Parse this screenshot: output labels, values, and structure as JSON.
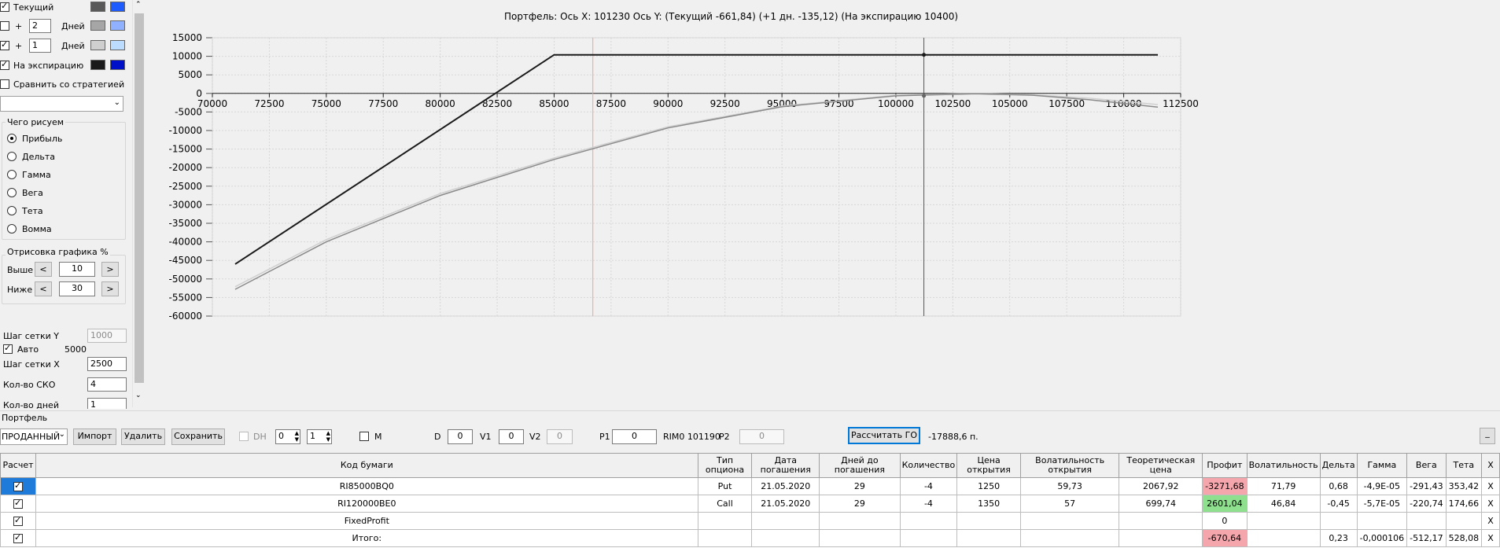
{
  "left": {
    "rows": [
      {
        "checked": true,
        "label": "Текущий",
        "swatch1": "#595959",
        "swatch2": "#1e5bff"
      },
      {
        "checked": false,
        "plus": "+",
        "value": "2",
        "unit": "Дней",
        "swatch1": "#a6a6a6",
        "swatch2": "#8fb1ff"
      },
      {
        "checked": true,
        "plus": "+",
        "value": "1",
        "unit": "Дней",
        "swatch1": "#cfcfcf",
        "swatch2": "#bcdcff"
      },
      {
        "checked": true,
        "label": "На экспирацию",
        "swatch1": "#1a1a1a",
        "swatch2": "#0010c8"
      }
    ],
    "compare_label": "Сравнить со стратегией",
    "draw_group_title": "Чего рисуем",
    "draw_options": [
      "Прибыль",
      "Дельта",
      "Гамма",
      "Вега",
      "Тета",
      "Вомма"
    ],
    "draw_selected": 0,
    "range_group_title": "Отрисовка графика %",
    "above_label": "Выше",
    "above_value": "10",
    "below_label": "Ниже",
    "below_value": "30",
    "dec": "<",
    "inc": ">",
    "grid_y_label": "Шаг сетки Y",
    "grid_y_value": "1000",
    "auto_label": "Авто",
    "auto_value": "5000",
    "grid_x_label": "Шаг сетки X",
    "grid_x_value": "2500",
    "sko_label": "Кол-во СКО",
    "sko_value": "4",
    "days_label": "Кол-во дней",
    "days_value": "1"
  },
  "chart_data": {
    "type": "line",
    "title": "Портфель: Ось X: 101230 Ось Y:  (Текущий -661,84)  (+1 дн. -135,12)  (На экспирацию 10400)",
    "x_ticks": [
      70000,
      72500,
      75000,
      77500,
      80000,
      82500,
      85000,
      87500,
      90000,
      92500,
      95000,
      97500,
      100000,
      102500,
      105000,
      107500,
      110000,
      112500
    ],
    "y_ticks": [
      15000,
      10000,
      5000,
      0,
      -5000,
      -10000,
      -15000,
      -20000,
      -25000,
      -30000,
      -35000,
      -40000,
      -45000,
      -50000,
      -55000,
      -60000
    ],
    "xlim": [
      70000,
      112500
    ],
    "ylim": [
      -60000,
      15000
    ],
    "grid": true,
    "cursor_x": 101230,
    "red_marker_x": 86700,
    "series": [
      {
        "color": "#1a1a1a",
        "x": [
          71000,
          85000,
          111500
        ],
        "y": [
          -46000,
          10400,
          10400
        ]
      },
      {
        "color": "#8a8a8a",
        "x": [
          71000,
          75000,
          80000,
          85000,
          90000,
          95000,
          100000,
          103500,
          106000,
          108500,
          111500
        ],
        "y": [
          -52800,
          -40000,
          -27500,
          -17800,
          -9300,
          -3600,
          -640,
          -100,
          -500,
          -1700,
          -3700
        ]
      },
      {
        "color": "#cfcfcf",
        "x": [
          71000,
          75000,
          80000,
          85000,
          90000,
          95000,
          100000,
          103500,
          106000,
          108500,
          111500
        ],
        "y": [
          -52100,
          -39400,
          -27000,
          -17400,
          -9000,
          -3400,
          -500,
          0,
          -350,
          -1300,
          -3000
        ]
      }
    ]
  },
  "bottom": {
    "tab": "Портфель",
    "combo_value": "ПРОДАННЫЙ",
    "import": "Импорт",
    "delete": "Удалить",
    "save": "Сохранить",
    "dh": "DH",
    "spin1": "0",
    "spin2": "1",
    "m": "M",
    "d_label": "D",
    "d_value": "0",
    "v1_label": "V1",
    "v1_value": "0",
    "v2_label": "V2",
    "v2_value": "0",
    "p1_label": "P1",
    "p1_value": "0",
    "rim": "RIM0 101190",
    "p2_label": "P2",
    "p2_value": "0",
    "calc_go": "Рассчитать ГО",
    "go_value": "-17888,6 п.",
    "min_btn": "_"
  },
  "table": {
    "headers": [
      "Расчет",
      "Код бумаги",
      "Тип опциона",
      "Дата погашения",
      "Дней до погашения",
      "Количество",
      "Цена открытия",
      "Волатильность открытия",
      "Теоретическая цена",
      "Профит",
      "Волатильность",
      "Дельта",
      "Гамма",
      "Вега",
      "Тета",
      "X"
    ],
    "rows": [
      [
        "",
        "RI85000BQ0",
        "Put",
        "21.05.2020",
        "29",
        "-4",
        "1250",
        "59,73",
        "2067,92",
        "-3271,68",
        "71,79",
        "0,68",
        "-4,9E-05",
        "-291,43",
        "353,42",
        "X"
      ],
      [
        "",
        "RI120000BE0",
        "Call",
        "21.05.2020",
        "29",
        "-4",
        "1350",
        "57",
        "699,74",
        "2601,04",
        "46,84",
        "-0,45",
        "-5,7E-05",
        "-220,74",
        "174,66",
        "X"
      ],
      [
        "",
        "FixedProfit",
        "",
        "",
        "",
        "",
        "",
        "",
        "",
        "0",
        "",
        "",
        "",
        "",
        "",
        "X"
      ],
      [
        "",
        "Итого:",
        "",
        "",
        "",
        "",
        "",
        "",
        "",
        "-670,64",
        "",
        "0,23",
        "-0,000106",
        "-512,17",
        "528,08",
        "X"
      ]
    ]
  }
}
